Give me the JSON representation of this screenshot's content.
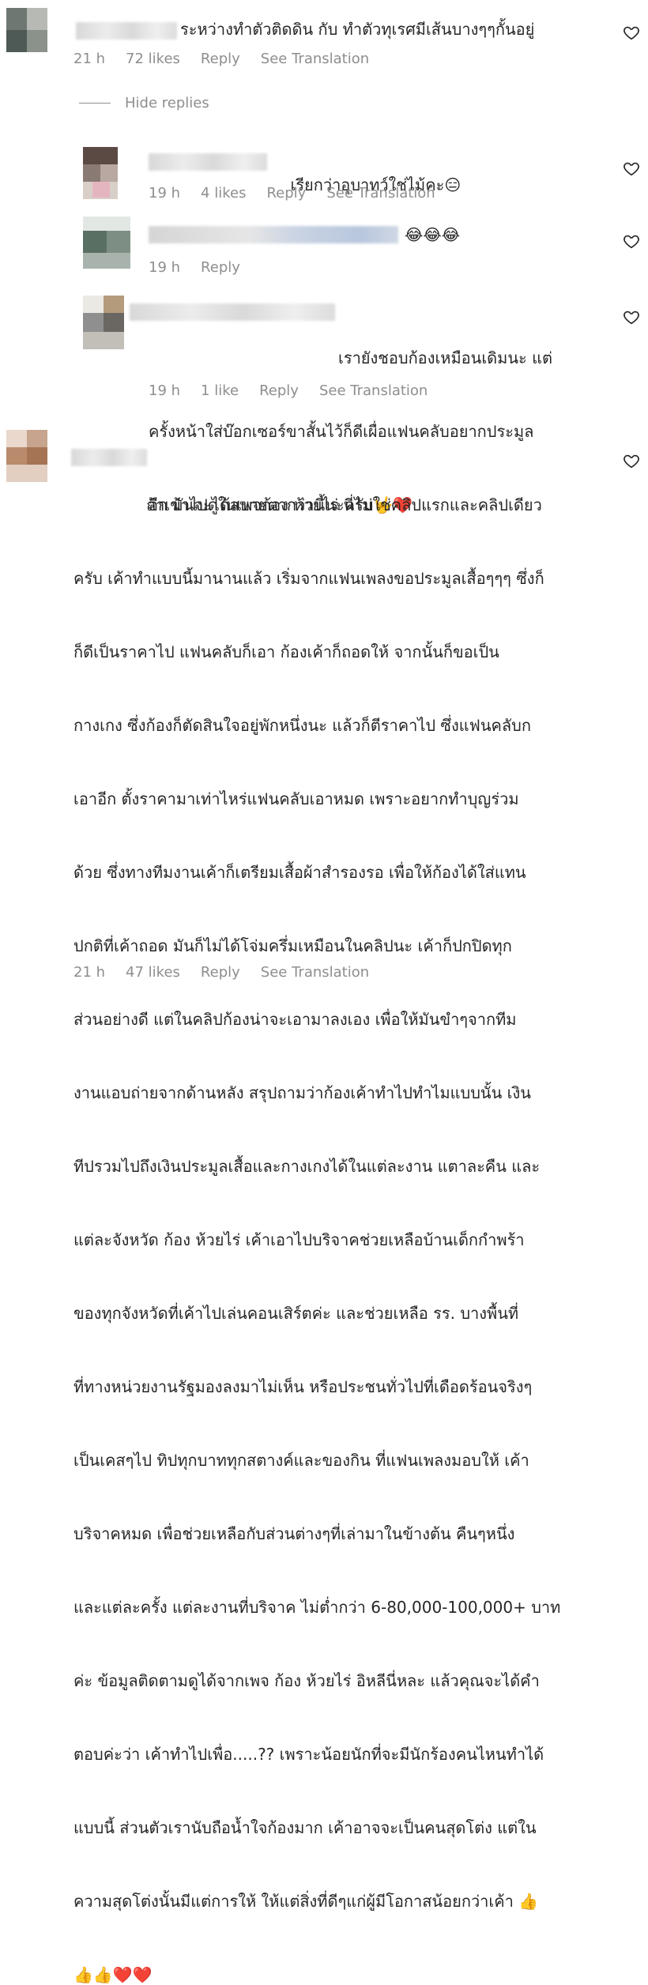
{
  "comments": [
    {
      "text": "ระหว่างทำตัวติดดิน กับ ทำตัวทุเรศมีเส้นบางๆๆกั้นอยู่",
      "time": "21 h",
      "likes": "72 likes",
      "reply": "Reply",
      "translate": "See Translation",
      "hide_replies": "Hide replies",
      "replies": [
        {
          "text": "เรียกว่าอุบาทว์ใช่ไม้คะ",
          "emoji": "😑",
          "time": "19 h",
          "likes": "4 likes",
          "reply": "Reply",
          "translate": "See Translation"
        },
        {
          "text": "😂😂😂",
          "time": "19 h",
          "reply": "Reply"
        },
        {
          "text_lines": [
            "เรายังชอบก้องเหมือนเดิมนะ แต่",
            "ครั้งหน้าใส่บ๊อกเซอร์ขาสั้นไว้ก็ดีเผื่อแฟนคลับอยากประมูล",
            "อีก มันจะได้สบายตากว่านี้นะครับ🤟❤️"
          ],
          "time": "19 h",
          "likes": "1 like",
          "reply": "Reply",
          "translate": "See Translation"
        }
      ]
    },
    {
      "text_lines": [
        "ถ้าเข้าไปดูในเพจก้อง ห้วยไร่ นี่ไม่ใช่คลิปแรกและคลิปเดียว",
        "ครับ เค้าทำแบบนี้มานานแล้ว เริ่มจากแฟนเพลงขอประมูลเสื้อๆๆๆ ซึ่งก็",
        "ก็ดีเป็นราคาไป แฟนคลับก็เอา ก้องเค้าก็ถอดให้ จากนั้นก็ขอเป็น",
        "กางเกง ซึ่งก้องก็ตัดสินใจอยู่พักหนึ่งนะ แล้วก็ตีราคาไป ซึ่งแฟนคลับก",
        "เอาอีก ตั้งราคามาเท่าไหร่แฟนคลับเอาหมด เพราะอยากทำบุญร่วม",
        "ด้วย ซึ่งทางทีมงานเค้าก็เตรียมเสื้อผ้าสำรองรอ เพื่อให้ก้องได้ใส่แทน",
        "ปกติที่เค้าถอด มันก็ไม่ได้โจ่มครึ่มเหมือนในคลิปนะ เค้าก็ปกปิดทุก",
        "ส่วนอย่างดี แต่ในคลิปก้องน่าจะเอามาลงเอง เพื่อให้มันขำๆจากทีม",
        "งานแอบถ่ายจากด้านหลัง สรุปถามว่าก้องเค้าทำไปทำไมแบบนั้น เงิน",
        "ทีปรวมไปถึงเงินประมูลเสื้อและกางเกงได้ในแต่ละงาน แตาละคืน และ",
        "แต่ละจังหวัด ก้อง ห้วยไร่ เค้าเอาไปบริจาคช่วยเหลือบ้านเด็กกำพร้า",
        "ของทุกจังหวัดที่เค้าไปเล่นคอนเสิร์ตค่ะ และช่วยเหลือ รร. บางพื้นที่",
        "ที่ทางหน่วยงานรัฐมองลงมาไม่เห็น หรือประชนทั่วไปที่เดือดร้อนจริงๆ",
        "เป็นเคสๆไป ทิปทุกบาททุกสตางค์และของกิน ที่แฟนเพลงมอบให้ เค้า",
        "บริจาคหมด เพื่อช่วยเหลือกับส่วนต่างๆที่เล่ามาในข้างต้น คืนๆหนึ่ง",
        "และแต่ละครั้ง แต่ละงานที่บริจาค ไม่ต่ำกว่า 6-80,000-100,000+ บาท",
        "ค่ะ ข้อมูลติดตามดูได้จากเพจ ก้อง ห้วยไร่ อิหลีนี่หละ แล้วคุณจะได้คำ",
        "ตอบค่ะว่า เค้าทำไปเพื่อ.....?? เพราะน้อยนักที่จะมีนักร้องคนไหนทำได้",
        "แบบนี้ ส่วนตัวเรานับถือน้ำใจก้องมาก เค้าอาจจะเป็นคนสุดโต่ง แต่ใน",
        "ความสุดโต่งนั้นมีแต่การให้ ให้แต่สิ่งที่ดีๆแก่ผู้มีโอกาสน้อยกว่าเค้า 👍",
        "👍👍❤️❤️"
      ],
      "time": "21 h",
      "likes": "47 likes",
      "reply": "Reply",
      "translate": "See Translation"
    }
  ],
  "colors": {
    "text": "#262626",
    "meta": "#8e8e8e",
    "heart_outline": "#262626",
    "red_heart": "#e0192e"
  },
  "icons": [
    "heart-outline-icon",
    "avatar"
  ]
}
